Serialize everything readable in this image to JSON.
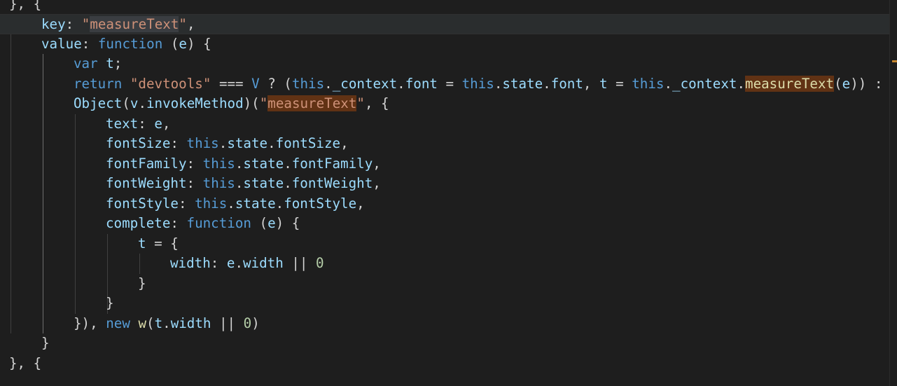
{
  "editor": {
    "lines": [
      {
        "tokens": [
          {
            "t": "}, {",
            "c": "p"
          }
        ]
      },
      {
        "tokens": [
          {
            "t": "key",
            "c": "pr"
          },
          {
            "t": ": ",
            "c": "p"
          },
          {
            "t": "\"",
            "c": "s"
          },
          {
            "t": "measureText",
            "c": "s sel"
          },
          {
            "t": "\"",
            "c": "s"
          },
          {
            "t": ",",
            "c": "p"
          }
        ]
      },
      {
        "tokens": [
          {
            "t": "value",
            "c": "pr"
          },
          {
            "t": ": ",
            "c": "p"
          },
          {
            "t": "function",
            "c": "k"
          },
          {
            "t": " (",
            "c": "p"
          },
          {
            "t": "e",
            "c": "pr"
          },
          {
            "t": ") {",
            "c": "p"
          }
        ]
      },
      {
        "tokens": [
          {
            "t": "var",
            "c": "k"
          },
          {
            "t": " ",
            "c": "p"
          },
          {
            "t": "t",
            "c": "pr"
          },
          {
            "t": ";",
            "c": "p"
          }
        ]
      },
      {
        "tokens": [
          {
            "t": "return",
            "c": "k"
          },
          {
            "t": " ",
            "c": "p"
          },
          {
            "t": "\"devtools\"",
            "c": "s"
          },
          {
            "t": " === ",
            "c": "p"
          },
          {
            "t": "V",
            "c": "k"
          },
          {
            "t": " ? (",
            "c": "p"
          },
          {
            "t": "this",
            "c": "k"
          },
          {
            "t": ".",
            "c": "p"
          },
          {
            "t": "_context",
            "c": "pr"
          },
          {
            "t": ".",
            "c": "p"
          },
          {
            "t": "font",
            "c": "pr"
          },
          {
            "t": " = ",
            "c": "p"
          },
          {
            "t": "this",
            "c": "k"
          },
          {
            "t": ".",
            "c": "p"
          },
          {
            "t": "state",
            "c": "pr"
          },
          {
            "t": ".",
            "c": "p"
          },
          {
            "t": "font",
            "c": "pr"
          },
          {
            "t": ", ",
            "c": "p"
          },
          {
            "t": "t",
            "c": "pr"
          },
          {
            "t": " = ",
            "c": "p"
          },
          {
            "t": "this",
            "c": "k"
          },
          {
            "t": ".",
            "c": "p"
          },
          {
            "t": "_context",
            "c": "pr"
          },
          {
            "t": ".",
            "c": "p"
          },
          {
            "t": "measureText",
            "c": "f find"
          },
          {
            "t": "(",
            "c": "p"
          },
          {
            "t": "e",
            "c": "pr"
          },
          {
            "t": ")) :",
            "c": "p"
          }
        ]
      },
      {
        "tokens": [
          {
            "t": "Object",
            "c": "pr"
          },
          {
            "t": "(",
            "c": "p"
          },
          {
            "t": "v",
            "c": "pr"
          },
          {
            "t": ".",
            "c": "p"
          },
          {
            "t": "invokeMethod",
            "c": "pr"
          },
          {
            "t": ")(",
            "c": "p"
          },
          {
            "t": "\"",
            "c": "s"
          },
          {
            "t": "measureText",
            "c": "s find"
          },
          {
            "t": "\"",
            "c": "s"
          },
          {
            "t": ", {",
            "c": "p"
          }
        ]
      },
      {
        "tokens": [
          {
            "t": "text",
            "c": "pr"
          },
          {
            "t": ": ",
            "c": "p"
          },
          {
            "t": "e",
            "c": "pr"
          },
          {
            "t": ",",
            "c": "p"
          }
        ]
      },
      {
        "tokens": [
          {
            "t": "fontSize",
            "c": "pr"
          },
          {
            "t": ": ",
            "c": "p"
          },
          {
            "t": "this",
            "c": "k"
          },
          {
            "t": ".",
            "c": "p"
          },
          {
            "t": "state",
            "c": "pr"
          },
          {
            "t": ".",
            "c": "p"
          },
          {
            "t": "fontSize",
            "c": "pr"
          },
          {
            "t": ",",
            "c": "p"
          }
        ]
      },
      {
        "tokens": [
          {
            "t": "fontFamily",
            "c": "pr"
          },
          {
            "t": ": ",
            "c": "p"
          },
          {
            "t": "this",
            "c": "k"
          },
          {
            "t": ".",
            "c": "p"
          },
          {
            "t": "state",
            "c": "pr"
          },
          {
            "t": ".",
            "c": "p"
          },
          {
            "t": "fontFamily",
            "c": "pr"
          },
          {
            "t": ",",
            "c": "p"
          }
        ]
      },
      {
        "tokens": [
          {
            "t": "fontWeight",
            "c": "pr"
          },
          {
            "t": ": ",
            "c": "p"
          },
          {
            "t": "this",
            "c": "k"
          },
          {
            "t": ".",
            "c": "p"
          },
          {
            "t": "state",
            "c": "pr"
          },
          {
            "t": ".",
            "c": "p"
          },
          {
            "t": "fontWeight",
            "c": "pr"
          },
          {
            "t": ",",
            "c": "p"
          }
        ]
      },
      {
        "tokens": [
          {
            "t": "fontStyle",
            "c": "pr"
          },
          {
            "t": ": ",
            "c": "p"
          },
          {
            "t": "this",
            "c": "k"
          },
          {
            "t": ".",
            "c": "p"
          },
          {
            "t": "state",
            "c": "pr"
          },
          {
            "t": ".",
            "c": "p"
          },
          {
            "t": "fontStyle",
            "c": "pr"
          },
          {
            "t": ",",
            "c": "p"
          }
        ]
      },
      {
        "tokens": [
          {
            "t": "complete",
            "c": "pr"
          },
          {
            "t": ": ",
            "c": "p"
          },
          {
            "t": "function",
            "c": "k"
          },
          {
            "t": " (",
            "c": "p"
          },
          {
            "t": "e",
            "c": "pr"
          },
          {
            "t": ") {",
            "c": "p"
          }
        ]
      },
      {
        "tokens": [
          {
            "t": "t",
            "c": "pr"
          },
          {
            "t": " = {",
            "c": "p"
          }
        ]
      },
      {
        "tokens": [
          {
            "t": "width",
            "c": "pr"
          },
          {
            "t": ": ",
            "c": "p"
          },
          {
            "t": "e",
            "c": "pr"
          },
          {
            "t": ".",
            "c": "p"
          },
          {
            "t": "width",
            "c": "pr"
          },
          {
            "t": " || ",
            "c": "p"
          },
          {
            "t": "0",
            "c": "n"
          }
        ]
      },
      {
        "tokens": [
          {
            "t": "}",
            "c": "p"
          }
        ]
      },
      {
        "tokens": [
          {
            "t": "}",
            "c": "p"
          }
        ]
      },
      {
        "tokens": [
          {
            "t": "}), ",
            "c": "p"
          },
          {
            "t": "new",
            "c": "k"
          },
          {
            "t": " ",
            "c": "p"
          },
          {
            "t": "w",
            "c": "f"
          },
          {
            "t": "(",
            "c": "p"
          },
          {
            "t": "t",
            "c": "pr"
          },
          {
            "t": ".",
            "c": "p"
          },
          {
            "t": "width",
            "c": "pr"
          },
          {
            "t": " || ",
            "c": "p"
          },
          {
            "t": "0",
            "c": "n"
          },
          {
            "t": ")",
            "c": "p"
          }
        ]
      },
      {
        "tokens": [
          {
            "t": "}",
            "c": "p"
          }
        ]
      },
      {
        "tokens": [
          {
            "t": "}, {",
            "c": "p"
          }
        ]
      }
    ]
  }
}
